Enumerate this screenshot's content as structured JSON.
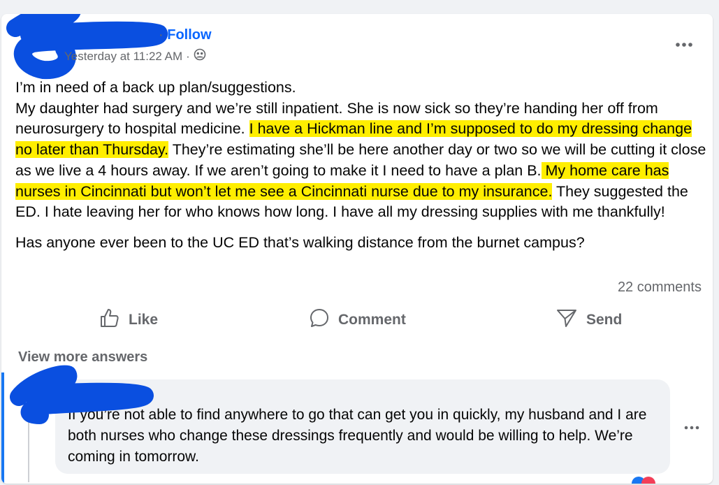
{
  "post": {
    "follow_separator": "·",
    "follow_label": "Follow",
    "timestamp": "Yesterday at 11:22 AM",
    "timestamp_separator": "·",
    "audience_icon": "friends-icon",
    "more_icon": "more-horizontal-icon",
    "body": {
      "line1": "I’m in need of a back up plan/suggestions.",
      "p2_part1": "My daughter had surgery and we’re still inpatient. She is now sick so they’re handing her off from neurosurgery to hospital medicine. ",
      "p2_highlight1": "I have a Hickman line and I’m supposed to do my dressing change no later than Thursday.",
      "p2_part2": " They’re estimating she’ll be here another day or two so we will be cutting it close as we live a 4 hours away. If we aren’t going to make it I need to have a plan B.",
      "p2_highlight2": " My home care has nurses in Cincinnati but won’t let me see a Cincinnati nurse due to my insurance.",
      "p2_part3": " They suggested the ED. I hate leaving her for who knows how long. I have all my dressing supplies with me thankfully!",
      "question": "Has anyone ever been to the UC ED that’s walking distance from the burnet campus?"
    },
    "comments_count": "22 comments",
    "highlight_color": "#ffee00",
    "redaction_color": "#0a4fe0"
  },
  "actions": {
    "like_label": "Like",
    "like_icon": "thumbs-up-icon",
    "comment_label": "Comment",
    "comment_icon": "comment-bubble-icon",
    "send_label": "Send",
    "send_icon": "send-icon"
  },
  "comments": {
    "view_more_label": "View more answers",
    "reply": {
      "text": "If you’re not able to find anywhere to go that can get you in quickly, my husband and I are both nurses who change these dressings frequently and would be willing to help. We’re coming in tomorrow.",
      "more_icon": "more-horizontal-icon"
    }
  }
}
